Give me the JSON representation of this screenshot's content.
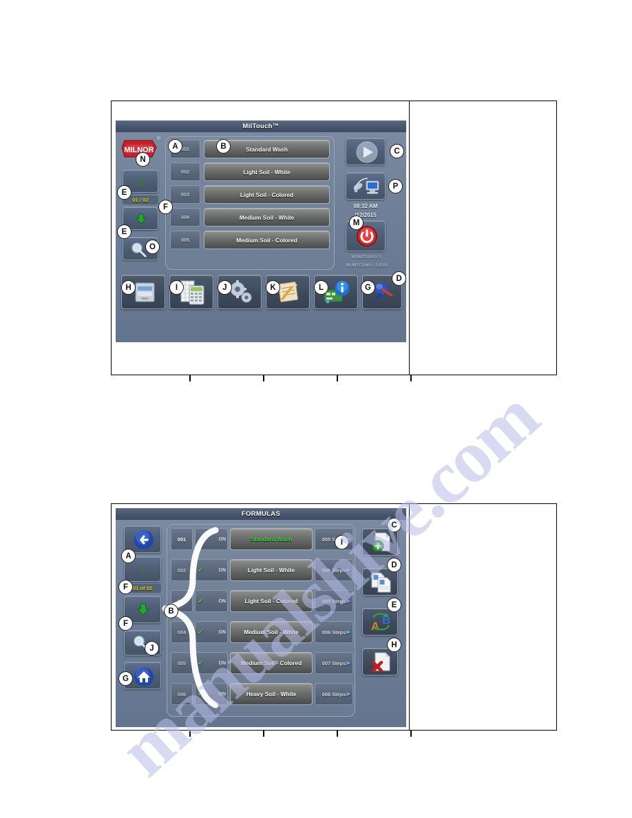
{
  "watermark": {
    "line1": "manualshive.com"
  },
  "figure1": {
    "screen_title": "MilTouch™",
    "logo_text": "MILNOR",
    "logo_reg": "®",
    "page_indicator": "01 / 02",
    "clock_time": "08:32 AM",
    "clock_date": "/12/2015",
    "device_line1": "WUMTGUIA / 3",
    "device_line2": "WUMTCOMA / 31030",
    "formulas": [
      {
        "number": "001",
        "name": "Standard Wash"
      },
      {
        "number": "002",
        "name": "Light Soil - White"
      },
      {
        "number": "003",
        "name": "Light Soil - Colored"
      },
      {
        "number": "004",
        "name": "Medium Soil - White"
      },
      {
        "number": "005",
        "name": "Medium Soil - Colored"
      }
    ],
    "callouts": [
      {
        "letter": "N",
        "name": "callout-n-logo"
      },
      {
        "letter": "A",
        "name": "callout-a-formula-number"
      },
      {
        "letter": "B",
        "name": "callout-b-formula-name"
      },
      {
        "letter": "C",
        "name": "callout-c-run-button"
      },
      {
        "letter": "P",
        "name": "callout-p-network-button"
      },
      {
        "letter": "E",
        "name": "callout-e-scroll-up"
      },
      {
        "letter": "F",
        "name": "callout-f-page-indicator"
      },
      {
        "letter": "E",
        "name": "callout-e-scroll-down"
      },
      {
        "letter": "O",
        "name": "callout-o-search"
      },
      {
        "letter": "M",
        "name": "callout-m-power"
      },
      {
        "letter": "D",
        "name": "callout-d-device-id"
      },
      {
        "letter": "H",
        "name": "callout-h-washer"
      },
      {
        "letter": "I",
        "name": "callout-i-calculator"
      },
      {
        "letter": "J",
        "name": "callout-j-configure"
      },
      {
        "letter": "K",
        "name": "callout-k-notes"
      },
      {
        "letter": "L",
        "name": "callout-l-diagnostics"
      },
      {
        "letter": "G",
        "name": "callout-g-tools"
      }
    ],
    "toolbar_icons": [
      {
        "icon": "washer-icon",
        "letter": "H"
      },
      {
        "icon": "calculator-icon",
        "letter": "I"
      },
      {
        "icon": "gears-icon",
        "letter": "J"
      },
      {
        "icon": "notepad-pencil-icon",
        "letter": "K"
      },
      {
        "icon": "circuit-info-icon",
        "letter": "L"
      },
      {
        "icon": "pushpin-icon",
        "letter": "G"
      }
    ],
    "side_icons": {
      "run": "play-circle-icon",
      "network": "network-computer-icon",
      "power": "power-button-icon",
      "scroll_up": "arrow-up-icon",
      "scroll_down": "arrow-down-icon",
      "search": "magnifier-icon"
    }
  },
  "figure2": {
    "screen_title": "FORMULAS",
    "page_indicator": "01 of 02",
    "rows": [
      {
        "number": "001",
        "enabled_label": "ON",
        "name": "Standard Wash",
        "steps": "005 Steps",
        "selected": true
      },
      {
        "number": "002",
        "enabled_label": "ON",
        "name": "Light Soil - White",
        "steps": "005 Steps",
        "selected": false
      },
      {
        "number": "003",
        "enabled_label": "ON",
        "name": "Light Soil - Colored",
        "steps": "005 Steps",
        "selected": false
      },
      {
        "number": "004",
        "enabled_label": "ON",
        "name": "Medium Soil - White",
        "steps": "006 Steps",
        "selected": false
      },
      {
        "number": "005",
        "enabled_label": "ON",
        "name": "Medium Soil - Colored",
        "steps": "007 Steps",
        "selected": false
      },
      {
        "number": "006",
        "enabled_label": "ON",
        "name": "Heavy Soil - White",
        "steps": "006 Steps",
        "selected": false
      }
    ],
    "callouts": [
      {
        "letter": "A",
        "name": "callout-a-back"
      },
      {
        "letter": "F",
        "name": "callout-f-scroll-up"
      },
      {
        "letter": "F",
        "name": "callout-f-scroll-down"
      },
      {
        "letter": "J",
        "name": "callout-j-search"
      },
      {
        "letter": "G",
        "name": "callout-g-home"
      },
      {
        "letter": "B",
        "name": "callout-b-formula-rows"
      },
      {
        "letter": "I",
        "name": "callout-i-steps"
      },
      {
        "letter": "C",
        "name": "callout-c-new-formula"
      },
      {
        "letter": "D",
        "name": "callout-d-copy-formula"
      },
      {
        "letter": "E",
        "name": "callout-e-rename-formula"
      },
      {
        "letter": "H",
        "name": "callout-h-delete-formula"
      }
    ],
    "side_icons": {
      "back": "back-arrow-icon",
      "scroll_up": "arrow-up-icon",
      "scroll_down": "arrow-down-icon",
      "search": "magnifier-icon",
      "home": "home-icon",
      "new": "new-document-icon",
      "copy": "copy-document-icon",
      "rename": "swap-ab-icon",
      "delete": "delete-document-icon"
    }
  },
  "colors": {
    "accent_yellow": "#e8e000",
    "accent_green": "#33e033",
    "power_red": "#d22b2b",
    "logo_red": "#c8202a",
    "screen_bg": "#6d7e96",
    "titlebar": "#47556e"
  }
}
